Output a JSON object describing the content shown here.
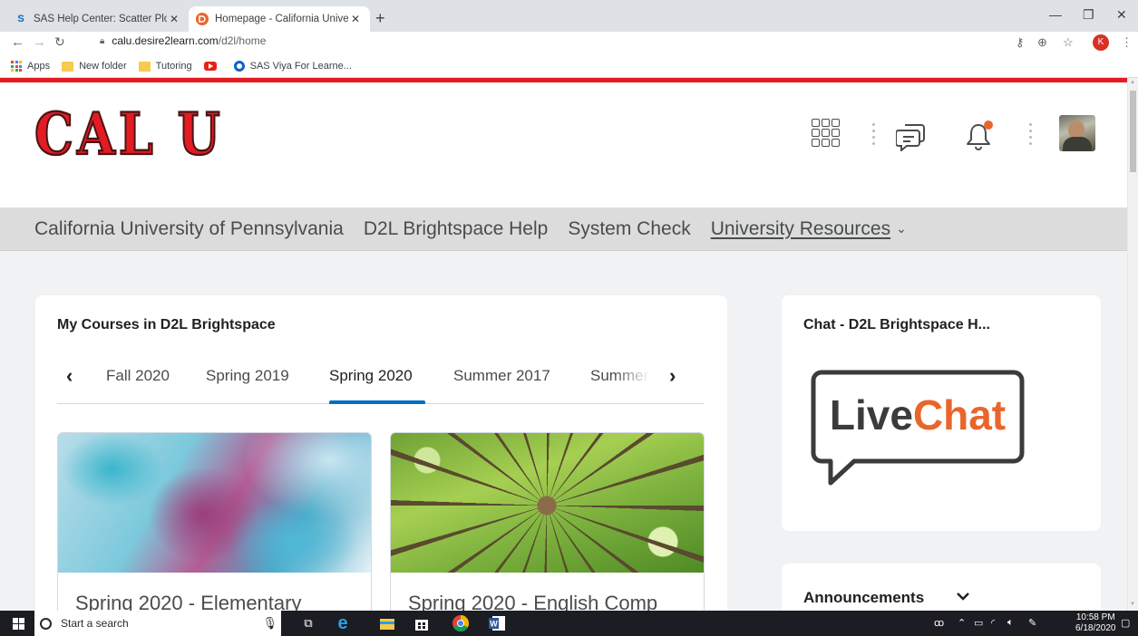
{
  "browser": {
    "tabs": [
      {
        "title": "SAS Help Center: Scatter Plot: Sel",
        "favicon": "sas-icon",
        "active": false
      },
      {
        "title": "Homepage - California University",
        "favicon": "d2l-icon",
        "active": true
      }
    ],
    "url_host": "calu.desire2learn.com",
    "url_path": "/d2l/home",
    "profile_initial": "K",
    "bookmarks": [
      {
        "label": "Apps",
        "icon": "apps-grid-icon"
      },
      {
        "label": "New folder",
        "icon": "folder-icon"
      },
      {
        "label": "Tutoring",
        "icon": "folder-icon"
      },
      {
        "label": "",
        "icon": "youtube-icon"
      },
      {
        "label": "SAS Viya For Learne...",
        "icon": "sas-viya-icon"
      }
    ]
  },
  "site": {
    "logo_text": "CAL U",
    "brand_color": "#e31b23",
    "nav": [
      {
        "label": "California University of Pennsylvania"
      },
      {
        "label": "D2L Brightspace Help"
      },
      {
        "label": "System Check"
      },
      {
        "label": "University Resources",
        "dropdown": true
      }
    ]
  },
  "courses_widget": {
    "title": "My Courses in D2L Brightspace",
    "tabs": [
      "Fall 2020",
      "Spring 2019",
      "Spring 2020",
      "Summer 2017",
      "Summer"
    ],
    "selected_tab": "Spring 2020",
    "cards": [
      {
        "title": "Spring 2020 - Elementary",
        "image": "abstract-ink-image"
      },
      {
        "title": "Spring 2020 - English Comp",
        "image": "tree-canopy-image"
      }
    ]
  },
  "chat_widget": {
    "title": "Chat - D2L Brightspace H...",
    "logo_word_1": "Live",
    "logo_word_2": "Chat",
    "accent": "#e8662c"
  },
  "announcements_widget": {
    "title": "Announcements"
  },
  "taskbar": {
    "search_placeholder": "Start a search",
    "time": "10:58 PM",
    "date": "6/18/2020"
  }
}
